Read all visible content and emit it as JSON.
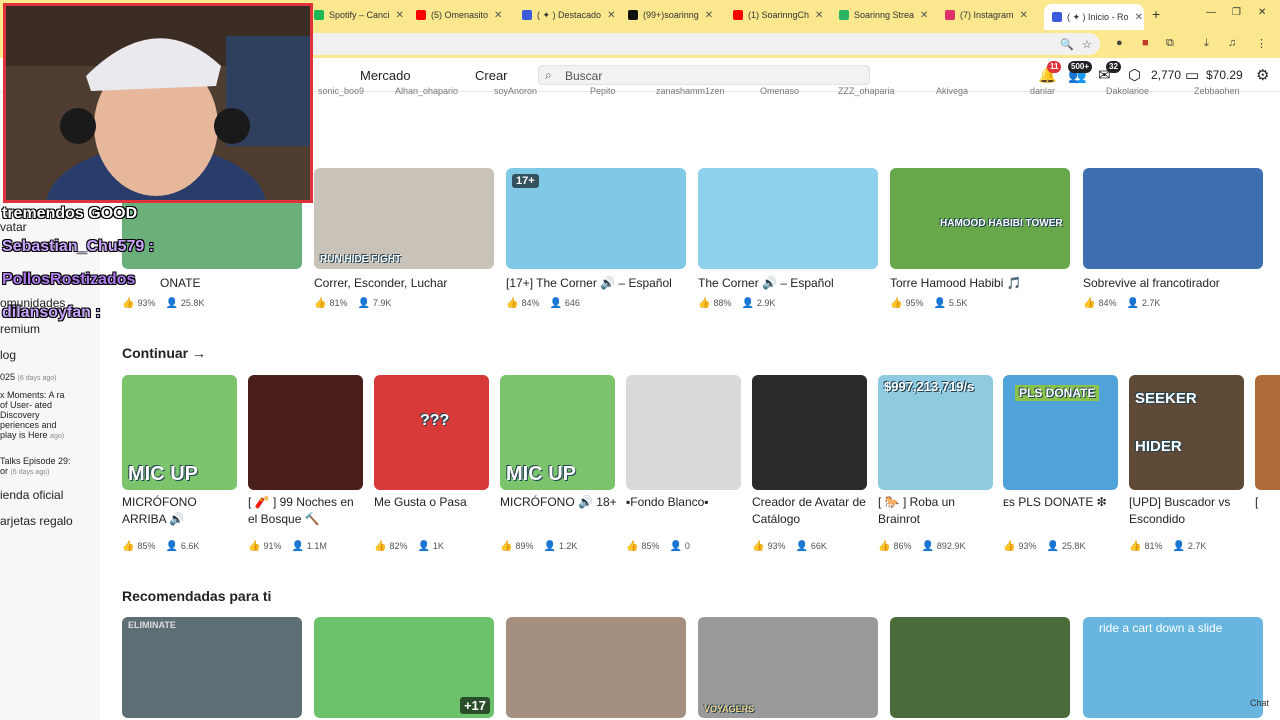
{
  "browser": {
    "tabs": [
      {
        "title": "Spotify – Canci",
        "color": "#1db954"
      },
      {
        "title": "(5) Omenasito",
        "color": "#ff0000"
      },
      {
        "title": "( ✦ ) Destacado",
        "color": "#3b5bdb"
      },
      {
        "title": "(99+)soarinng",
        "color": "#111111"
      },
      {
        "title": "(1) SoarinngCh",
        "color": "#ff0000"
      },
      {
        "title": "Soarinng Strea",
        "color": "#28b463"
      },
      {
        "title": "(7) Instagram",
        "color": "#e1306c"
      },
      {
        "title": "( ✦ ) Inicio - Ro",
        "color": "#3b5bdb"
      }
    ],
    "new_tab": "+",
    "window_controls": [
      "—",
      "❐",
      "✕"
    ]
  },
  "header": {
    "nav": [
      "Mercado",
      "Crear"
    ],
    "search_placeholder": "Buscar",
    "notifications_count": "11",
    "friends_count": "500+",
    "messages_count": "32",
    "robux": "2,770",
    "balance": "$70.29",
    "friend_names": [
      "sonic_boo9",
      "Alhan_ohapario",
      "soyAnoron",
      "Pepito",
      "zanashamm1zen",
      "Omenaso",
      "ZZZ_ohaparia",
      "Akivega",
      "danlar",
      "Dakolarioe",
      "Zebbaohen"
    ]
  },
  "sidebar": {
    "items": [
      {
        "label": "vatar"
      },
      {
        "label": "omunidades"
      },
      {
        "label": "remium"
      },
      {
        "label": "log"
      }
    ],
    "blog_posts": [
      {
        "title": "025",
        "date": "(6 days ago)"
      },
      {
        "title": "x Moments: A ra of User- ated Discovery periences and play is Here",
        "date": "ago)"
      },
      {
        "title": "Talks Episode 29: or",
        "date": "(6 days ago)"
      }
    ],
    "shop": "ienda oficial",
    "gift_cards": "arjetas regalo"
  },
  "sections": {
    "top_row": [
      {
        "title": "ONATE",
        "emoji": "❇",
        "rating": "93%",
        "players": "25.8K",
        "bg": "#6bb07a",
        "tag": ""
      },
      {
        "title": "Correr, Esconder, Luchar",
        "rating": "81%",
        "players": "7.9K",
        "bg": "#c9c2b8",
        "tag": "RUN HIDE FIGHT"
      },
      {
        "title": "[17+] The Corner 🔊 – Español",
        "rating": "84%",
        "players": "646",
        "bg": "#7fc9e6",
        "tag": "17+"
      },
      {
        "title": "The Corner 🔊 – Español",
        "rating": "88%",
        "players": "2.9K",
        "bg": "#8fd0ea",
        "tag": ""
      },
      {
        "title": "Torre Hamood Habibi 🎵",
        "rating": "95%",
        "players": "5.5K",
        "bg": "#68a84a",
        "tag": "HAMOOD HABIBI TOWER"
      },
      {
        "title": "Sobrevive al francotirador",
        "rating": "84%",
        "players": "2.7K",
        "bg": "#3d6fb0",
        "tag": ""
      }
    ],
    "continue_title": "Continuar →",
    "continue": [
      {
        "title": "MICRÓFONO ARRIBA 🔊",
        "rating": "85%",
        "players": "6.6K",
        "bg": "#7bc46b",
        "label": "MIC UP"
      },
      {
        "title": "[ 🧨 ] 99 Noches en el Bosque 🔨",
        "rating": "91%",
        "players": "1.1M",
        "bg": "#4a1f1a",
        "label": ""
      },
      {
        "title": "Me Gusta o Pasa",
        "rating": "82%",
        "players": "1K",
        "bg": "#d83a3a",
        "label": "???"
      },
      {
        "title": "MICRÓFONO 🔊 18+",
        "rating": "89%",
        "players": "1.2K",
        "bg": "#7bc46b",
        "label": "MIC UP"
      },
      {
        "title": "▪Fondo Blanco▪",
        "rating": "85%",
        "players": "0",
        "bg": "#d9d9d9",
        "label": ""
      },
      {
        "title": "Creador de Avatar de Catálogo",
        "rating": "93%",
        "players": "66K",
        "bg": "#2b2b2b",
        "label": ""
      },
      {
        "title": "[ 🐎 ] Roba un Brainrot",
        "rating": "86%",
        "players": "892.9K",
        "bg": "#8ecbe0",
        "label": "$997,213,719/s"
      },
      {
        "title": "ᴇs PLS DONATE ❇",
        "rating": "93%",
        "players": "25.8K",
        "bg": "#4fa3d9",
        "label": "PLS DONATE"
      },
      {
        "title": "[UPD] Buscador vs Escondido",
        "rating": "81%",
        "players": "2.7K",
        "bg": "#5e4a36",
        "label": "SEEKER HIDER"
      },
      {
        "title": "[",
        "rating": "",
        "players": "",
        "bg": "#b06a3a",
        "label": ""
      }
    ],
    "recommended_title": "Recomendadas para ti",
    "recommended": [
      {
        "bg": "#5e6e75",
        "label": "ELIMINATE"
      },
      {
        "bg": "#6cc26a",
        "label": "+17"
      },
      {
        "bg": "#a59080",
        "label": ""
      },
      {
        "bg": "#9a9a9a",
        "label": "VOYAGERS"
      },
      {
        "bg": "#4a6b3a",
        "label": ""
      },
      {
        "bg": "#68b6e0",
        "label": "ride a cart down a slide"
      }
    ]
  },
  "overlay": {
    "chat": [
      {
        "text": "tremendos GOOD",
        "style": "white"
      },
      {
        "text": "Sebastian_Chu579 :",
        "style": "purple"
      },
      {
        "text": "PollosRostizados",
        "style": "purple2"
      },
      {
        "text": "dilansoyfan :",
        "style": "purple"
      }
    ]
  },
  "chat_widget": "Chat"
}
